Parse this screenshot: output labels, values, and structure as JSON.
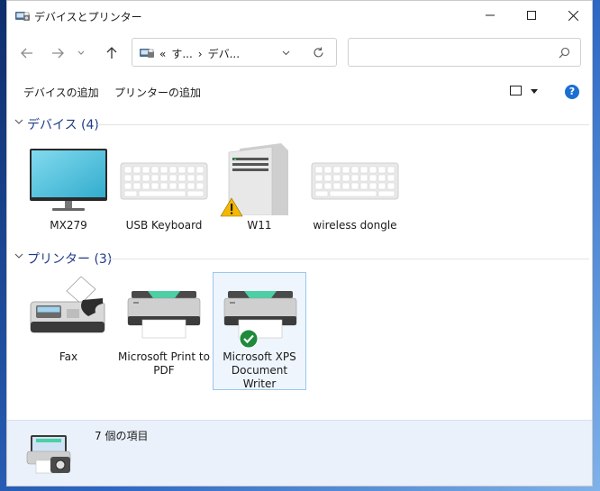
{
  "window": {
    "title": "デバイスとプリンター",
    "controls": [
      "minimize-icon",
      "maximize-icon",
      "close-icon"
    ]
  },
  "navigation": {
    "breadcrumb": [
      "«",
      "す...",
      "›",
      "デバ..."
    ],
    "search_placeholder": ""
  },
  "toolbar": {
    "add_device": "デバイスの追加",
    "add_printer": "プリンターの追加",
    "help": "?"
  },
  "groups": {
    "devices": {
      "label": "デバイス (4)",
      "items": [
        {
          "name": "MX279",
          "icon": "monitor-icon"
        },
        {
          "name": "USB Keyboard",
          "icon": "keyboard-icon"
        },
        {
          "name": "W11",
          "icon": "computer-tower-icon",
          "badge": "warning-icon"
        },
        {
          "name": "wireless dongle",
          "icon": "keyboard-icon"
        }
      ]
    },
    "printers": {
      "label": "プリンター (3)",
      "items": [
        {
          "name": "Fax",
          "icon": "fax-icon"
        },
        {
          "name": "Microsoft Print to PDF",
          "icon": "printer-icon"
        },
        {
          "name": "Microsoft XPS Document Writer",
          "icon": "printer-icon",
          "badge": "default-check-icon",
          "selected": true
        }
      ]
    }
  },
  "details": {
    "count_text": "7 個の項目",
    "icon": "devices-printers-icon"
  },
  "colors": {
    "accent": "#1c6fd1",
    "group_header": "#1e3a8a",
    "selection_bg": "#eef5fd",
    "selection_border": "#99c7ee",
    "details_bg": "#eaf1fb",
    "warning": "#f5b800",
    "check": "#1e8a3b"
  }
}
